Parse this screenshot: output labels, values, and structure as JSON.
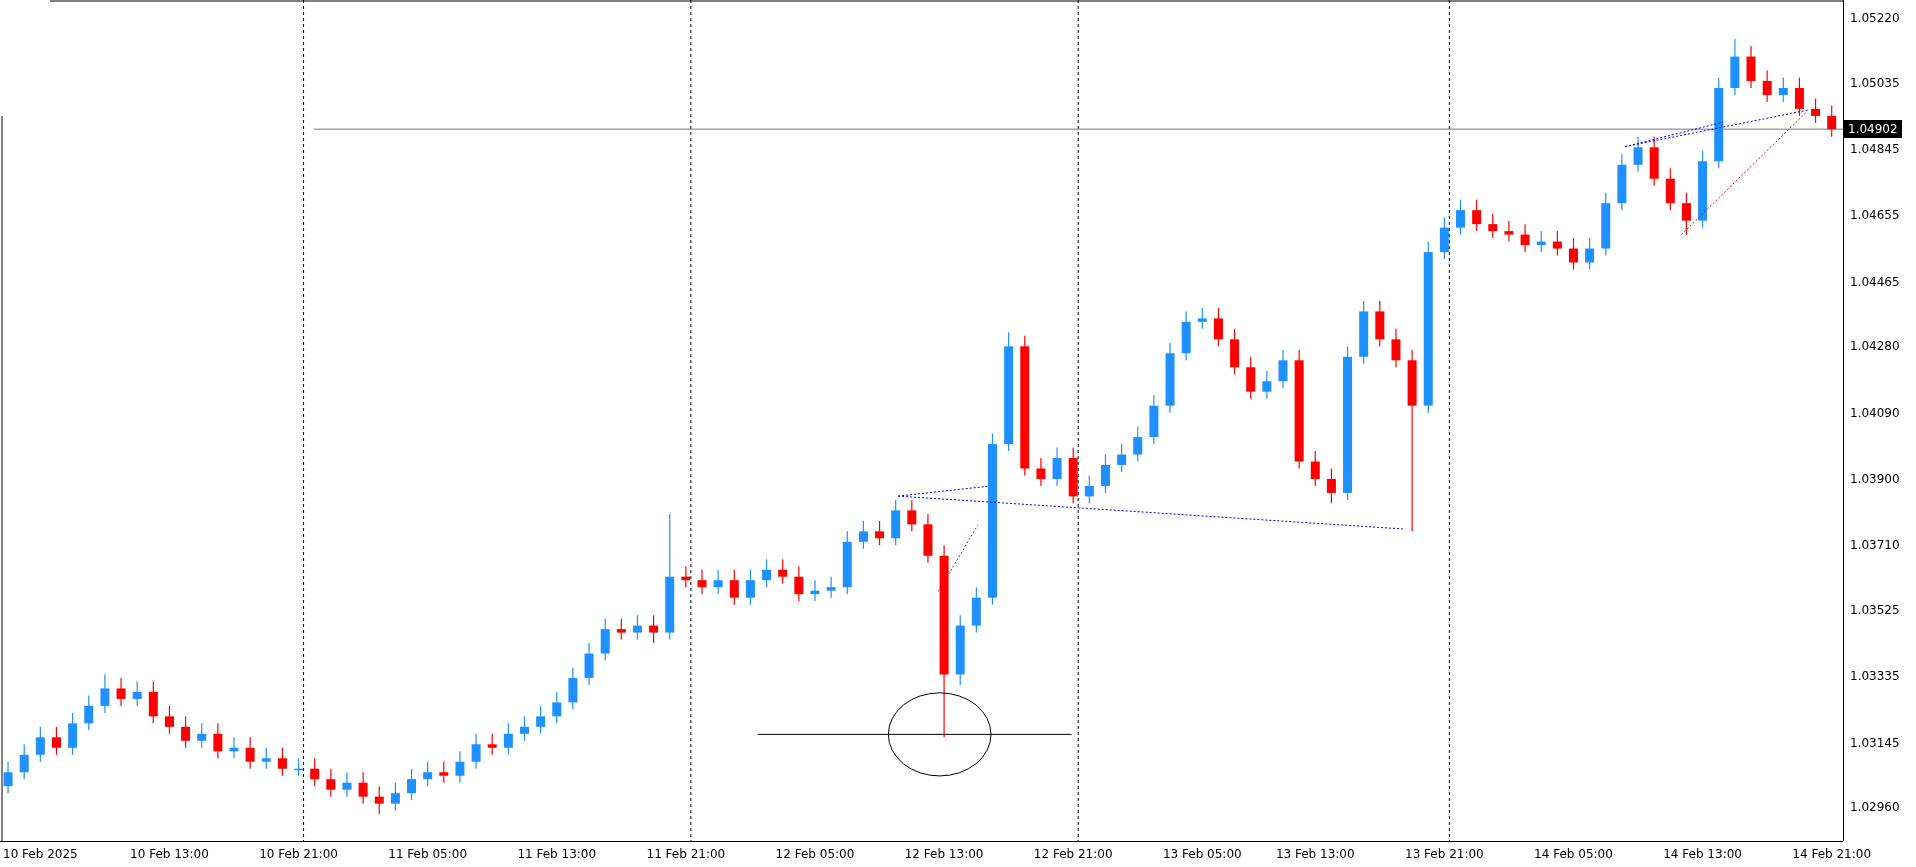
{
  "chart": {
    "chart_data": {
      "type": "candlestick",
      "categories": [
        null,
        null,
        "10 Feb 2025",
        null,
        null,
        null,
        null,
        null,
        null,
        null,
        "10 Feb 13:00",
        null,
        null,
        null,
        null,
        null,
        null,
        null,
        "10 Feb 21:00",
        null,
        null,
        null,
        null,
        null,
        null,
        null,
        "11 Feb 05:00",
        null,
        null,
        null,
        null,
        null,
        null,
        null,
        "11 Feb 13:00",
        null,
        null,
        null,
        null,
        null,
        null,
        null,
        "11 Feb 21:00",
        null,
        null,
        null,
        null,
        null,
        null,
        null,
        "12 Feb 05:00",
        null,
        null,
        null,
        null,
        null,
        null,
        null,
        "12 Feb 13:00",
        null,
        null,
        null,
        null,
        null,
        null,
        null,
        "12 Feb 21:00",
        null,
        null,
        null,
        null,
        null,
        null,
        null,
        "13 Feb 05:00",
        null,
        null,
        null,
        null,
        null,
        null,
        "13 Feb 13:00",
        null,
        null,
        null,
        null,
        null,
        null,
        null,
        "13 Feb 21:00",
        null,
        null,
        null,
        null,
        null,
        null,
        null,
        "14 Feb 05:00",
        null,
        null,
        null,
        null,
        null,
        null,
        null,
        "14 Feb 13:00",
        null,
        null,
        null,
        null,
        null,
        null,
        null,
        "14 Feb 21:00"
      ],
      "ohlc": [
        [
          1.0302,
          1.0309,
          1.03,
          1.0306
        ],
        [
          1.0306,
          1.0314,
          1.0304,
          1.0311
        ],
        [
          1.0311,
          1.0319,
          1.0309,
          1.0316
        ],
        [
          1.0316,
          1.0319,
          1.0311,
          1.0313
        ],
        [
          1.0313,
          1.0323,
          1.0311,
          1.032
        ],
        [
          1.032,
          1.0328,
          1.0318,
          1.0325
        ],
        [
          1.0325,
          1.0334,
          1.0323,
          1.033
        ],
        [
          1.033,
          1.0333,
          1.0325,
          1.0327
        ],
        [
          1.0327,
          1.0332,
          1.0325,
          1.0329
        ],
        [
          1.0329,
          1.0332,
          1.032,
          1.0322
        ],
        [
          1.0322,
          1.0325,
          1.0317,
          1.0319
        ],
        [
          1.0319,
          1.0322,
          1.0313,
          1.0315
        ],
        [
          1.0315,
          1.032,
          1.0313,
          1.0317
        ],
        [
          1.0317,
          1.032,
          1.031,
          1.0312
        ],
        [
          1.0312,
          1.0316,
          1.031,
          1.0313
        ],
        [
          1.0313,
          1.0316,
          1.0307,
          1.0309
        ],
        [
          1.0309,
          1.0313,
          1.0307,
          1.031
        ],
        [
          1.031,
          1.0313,
          1.0305,
          1.0307
        ],
        [
          1.0307,
          1.031,
          1.0305,
          1.0307
        ],
        [
          1.0307,
          1.031,
          1.0302,
          1.0304
        ],
        [
          1.0304,
          1.0307,
          1.0299,
          1.0301
        ],
        [
          1.0301,
          1.0306,
          1.0299,
          1.0303
        ],
        [
          1.0303,
          1.0306,
          1.0297,
          1.0299
        ],
        [
          1.0299,
          1.0302,
          1.0294,
          1.0297
        ],
        [
          1.0297,
          1.0303,
          1.0295,
          1.03
        ],
        [
          1.03,
          1.0307,
          1.0298,
          1.0304
        ],
        [
          1.0304,
          1.0309,
          1.0302,
          1.0306
        ],
        [
          1.0306,
          1.0309,
          1.0303,
          1.0305
        ],
        [
          1.0305,
          1.0312,
          1.0303,
          1.0309
        ],
        [
          1.0309,
          1.0317,
          1.0307,
          1.0314
        ],
        [
          1.0314,
          1.0317,
          1.0311,
          1.0313
        ],
        [
          1.0313,
          1.032,
          1.0311,
          1.0317
        ],
        [
          1.0317,
          1.0322,
          1.0315,
          1.0319
        ],
        [
          1.0319,
          1.0325,
          1.0317,
          1.0322
        ],
        [
          1.0322,
          1.0329,
          1.032,
          1.0326
        ],
        [
          1.0326,
          1.0336,
          1.0324,
          1.0333
        ],
        [
          1.0333,
          1.0343,
          1.0331,
          1.034
        ],
        [
          1.034,
          1.035,
          1.0338,
          1.0347
        ],
        [
          1.0347,
          1.035,
          1.0344,
          1.0346
        ],
        [
          1.0346,
          1.0351,
          1.0344,
          1.0348
        ],
        [
          1.0348,
          1.0351,
          1.0343,
          1.0346
        ],
        [
          1.0346,
          1.038,
          1.0344,
          1.0362
        ],
        [
          1.0362,
          1.0365,
          1.0359,
          1.0361
        ],
        [
          1.0361,
          1.0364,
          1.0357,
          1.0359
        ],
        [
          1.0359,
          1.0364,
          1.0357,
          1.0361
        ],
        [
          1.0361,
          1.0364,
          1.0354,
          1.0356
        ],
        [
          1.0356,
          1.0364,
          1.0354,
          1.0361
        ],
        [
          1.0361,
          1.0367,
          1.0359,
          1.0364
        ],
        [
          1.0364,
          1.0367,
          1.036,
          1.0362
        ],
        [
          1.0362,
          1.0365,
          1.0355,
          1.0357
        ],
        [
          1.0357,
          1.0361,
          1.0355,
          1.0358
        ],
        [
          1.0358,
          1.0362,
          1.0356,
          1.0359
        ],
        [
          1.0359,
          1.0375,
          1.0357,
          1.0372
        ],
        [
          1.0372,
          1.0378,
          1.037,
          1.0375
        ],
        [
          1.0375,
          1.0378,
          1.0371,
          1.0373
        ],
        [
          1.0373,
          1.0384,
          1.0371,
          1.0381
        ],
        [
          1.0381,
          1.0384,
          1.0375,
          1.0377
        ],
        [
          1.0377,
          1.038,
          1.0366,
          1.0368
        ],
        [
          1.0368,
          1.0371,
          1.0316,
          1.0334
        ],
        [
          1.0334,
          1.0351,
          1.0331,
          1.0348
        ],
        [
          1.0348,
          1.0359,
          1.0346,
          1.0356
        ],
        [
          1.0356,
          1.0403,
          1.0354,
          1.04
        ],
        [
          1.04,
          1.0432,
          1.0398,
          1.0428
        ],
        [
          1.0428,
          1.0431,
          1.0391,
          1.0393
        ],
        [
          1.0393,
          1.0396,
          1.0388,
          1.039
        ],
        [
          1.039,
          1.0399,
          1.0388,
          1.0396
        ],
        [
          1.0396,
          1.0399,
          1.0383,
          1.0385
        ],
        [
          1.0385,
          1.0391,
          1.0383,
          1.0388
        ],
        [
          1.0388,
          1.0397,
          1.0386,
          1.0394
        ],
        [
          1.0394,
          1.04,
          1.0392,
          1.0397
        ],
        [
          1.0397,
          1.0405,
          1.0395,
          1.0402
        ],
        [
          1.0402,
          1.0414,
          1.04,
          1.0411
        ],
        [
          1.0411,
          1.0429,
          1.0409,
          1.0426
        ],
        [
          1.0426,
          1.0438,
          1.0424,
          1.0435
        ],
        [
          1.0435,
          1.0439,
          1.0433,
          1.0436
        ],
        [
          1.0436,
          1.0439,
          1.0428,
          1.043
        ],
        [
          1.043,
          1.0433,
          1.042,
          1.0422
        ],
        [
          1.0422,
          1.0425,
          1.0413,
          1.0415
        ],
        [
          1.0415,
          1.0421,
          1.0413,
          1.0418
        ],
        [
          1.0418,
          1.0427,
          1.0416,
          1.0424
        ],
        [
          1.0424,
          1.0427,
          1.0393,
          1.0395
        ],
        [
          1.0395,
          1.0398,
          1.0388,
          1.039
        ],
        [
          1.039,
          1.0393,
          1.0383,
          1.0386
        ],
        [
          1.0386,
          1.0428,
          1.0384,
          1.0425
        ],
        [
          1.0425,
          1.0441,
          1.0423,
          1.0438
        ],
        [
          1.0438,
          1.0441,
          1.0428,
          1.043
        ],
        [
          1.043,
          1.0433,
          1.0422,
          1.0424
        ],
        [
          1.0424,
          1.0427,
          1.0375,
          1.0411
        ],
        [
          1.0411,
          1.0458,
          1.0409,
          1.0455
        ],
        [
          1.0455,
          1.0465,
          1.0453,
          1.0462
        ],
        [
          1.0462,
          1.047,
          1.046,
          1.0467
        ],
        [
          1.0467,
          1.047,
          1.0461,
          1.0463
        ],
        [
          1.0463,
          1.0466,
          1.0459,
          1.0461
        ],
        [
          1.0461,
          1.0464,
          1.0458,
          1.046
        ],
        [
          1.046,
          1.0463,
          1.0455,
          1.0457
        ],
        [
          1.0457,
          1.0461,
          1.0455,
          1.0458
        ],
        [
          1.0458,
          1.0461,
          1.0454,
          1.0456
        ],
        [
          1.0456,
          1.0459,
          1.045,
          1.0452
        ],
        [
          1.0452,
          1.0459,
          1.045,
          1.0456
        ],
        [
          1.0456,
          1.0472,
          1.0454,
          1.0469
        ],
        [
          1.0469,
          1.0483,
          1.0467,
          1.048
        ],
        [
          1.048,
          1.0488,
          1.0478,
          1.0485
        ],
        [
          1.0485,
          1.0488,
          1.0474,
          1.0476
        ],
        [
          1.0476,
          1.0479,
          1.0467,
          1.0469
        ],
        [
          1.0469,
          1.0472,
          1.046,
          1.0464
        ],
        [
          1.0464,
          1.0484,
          1.0462,
          1.0481
        ],
        [
          1.0481,
          1.0505,
          1.0479,
          1.0502
        ],
        [
          1.0502,
          1.0516,
          1.05,
          1.0511
        ],
        [
          1.0511,
          1.0514,
          1.0502,
          1.0504
        ],
        [
          1.0504,
          1.0507,
          1.0498,
          1.05
        ],
        [
          1.05,
          1.0505,
          1.0498,
          1.0502
        ],
        [
          1.0502,
          1.0505,
          1.0494,
          1.0496
        ],
        [
          1.0496,
          1.0499,
          1.0492,
          1.0494
        ],
        [
          1.0494,
          1.0497,
          1.0488,
          1.04902
        ]
      ],
      "ylim": [
        1.02863,
        1.05272
      ],
      "yticks": [
        {
          "value": 1.0522,
          "label": "1.05220"
        },
        {
          "value": 1.05035,
          "label": "1.05035"
        },
        {
          "value": 1.04845,
          "label": "1.04845"
        },
        {
          "value": 1.04655,
          "label": "1.04655"
        },
        {
          "value": 1.04465,
          "label": "1.04465"
        },
        {
          "value": 1.0428,
          "label": "1.04280"
        },
        {
          "value": 1.0409,
          "label": "1.04090"
        },
        {
          "value": 1.039,
          "label": "1.03900"
        },
        {
          "value": 1.0371,
          "label": "1.03710"
        },
        {
          "value": 1.03525,
          "label": "1.03525"
        },
        {
          "value": 1.03335,
          "label": "1.03335"
        },
        {
          "value": 1.03145,
          "label": "1.03145"
        },
        {
          "value": 1.0296,
          "label": "1.02960"
        }
      ],
      "ref_lines": [
        {
          "axis": "y",
          "value": 1.04902,
          "label": "1.04902"
        }
      ]
    }
  }
}
